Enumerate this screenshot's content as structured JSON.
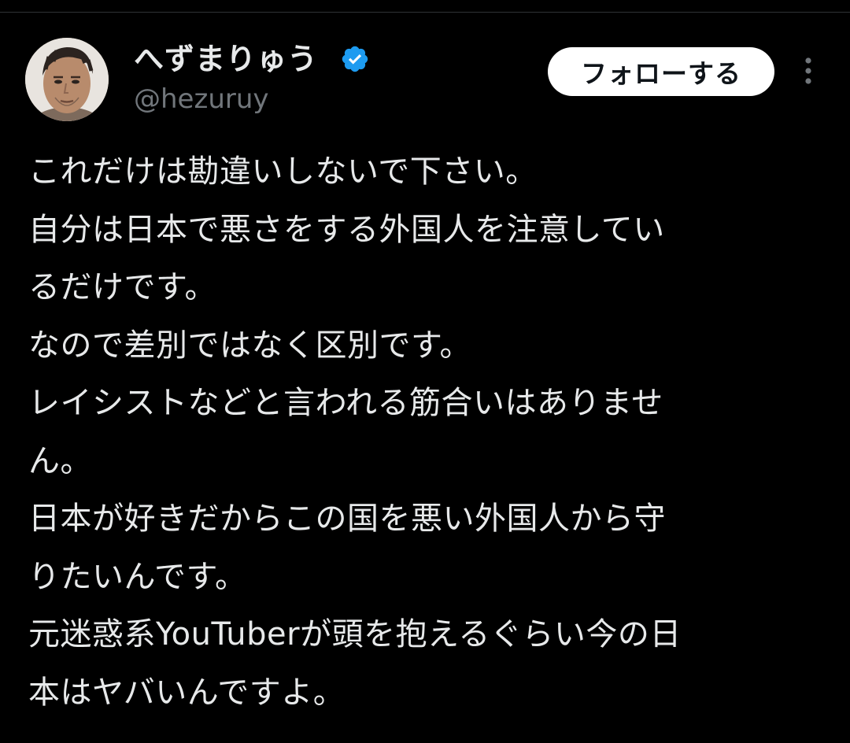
{
  "header": {
    "display_name": "へずまりゅう",
    "handle": "@hezuruy",
    "verified": true,
    "follow_label": "フォローする",
    "more_icon": "more-vertical-icon"
  },
  "tweet": {
    "lines": [
      "これだけは勘違いしないで下さい。",
      "自分は日本で悪さをする外国人を注意してい",
      "るだけです。",
      "なので差別ではなく区別です。",
      "レイシストなどと言われる筋合いはありませ",
      "ん。",
      "日本が好きだからこの国を悪い外国人から守",
      "りたいんです。",
      "元迷惑系YouTuberが頭を抱えるぐらい今の日",
      "本はヤバいんですよ。"
    ]
  },
  "colors": {
    "background": "#000000",
    "text": "#e7e9ea",
    "secondary_text": "#71767b",
    "verified_blue": "#1d9bf0",
    "button_bg": "#ffffff",
    "button_text": "#0f1419"
  }
}
